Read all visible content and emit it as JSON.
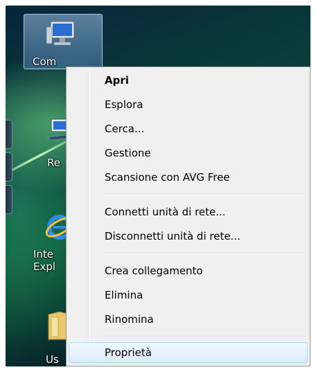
{
  "desktop": {
    "icons": [
      {
        "label": "Com",
        "icon": "computer-icon"
      },
      {
        "label": "Re",
        "icon": "network-icon"
      },
      {
        "label": "Inte",
        "label2": "Expl",
        "icon": "internet-explorer-icon"
      },
      {
        "label": "Us",
        "icon": "user-folder-icon"
      }
    ]
  },
  "context_menu": {
    "items": [
      {
        "label": "Apri",
        "default": true
      },
      {
        "label": "Esplora"
      },
      {
        "label": "Cerca..."
      },
      {
        "label": "Gestione"
      },
      {
        "label": "Scansione con AVG Free"
      },
      {
        "label": "Connetti unità di rete..."
      },
      {
        "label": "Disconnetti unità di rete..."
      },
      {
        "label": "Crea collegamento"
      },
      {
        "label": "Elimina"
      },
      {
        "label": "Rinomina"
      },
      {
        "label": "Proprietà",
        "highlighted": true
      }
    ]
  },
  "colors": {
    "menu_background": "#f0f0f0",
    "menu_highlight_border": "#a8d8eb",
    "desktop_green": "#0d5a36"
  }
}
